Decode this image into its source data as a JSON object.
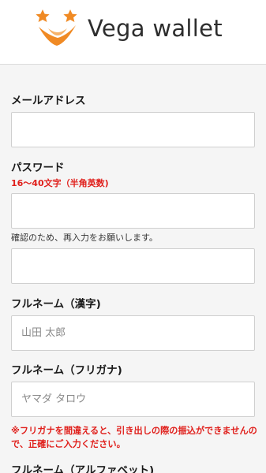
{
  "header": {
    "logo_text": "Vega wallet"
  },
  "form": {
    "email": {
      "label": "メールアドレス",
      "value": "",
      "placeholder": ""
    },
    "password": {
      "label": "パスワード",
      "rule": "16〜40文字（半角英数)",
      "value": "",
      "confirm_note": "確認のため、再入力をお願いします。",
      "confirm_value": ""
    },
    "fullname_kanji": {
      "label": "フルネーム（漢字)",
      "placeholder": "山田 太郎"
    },
    "fullname_kana": {
      "label": "フルネーム（フリガナ)",
      "placeholder": "ヤマダ タロウ"
    },
    "kana_warning": "※フリガナを間違えると、引き出しの際の振込ができませんので、正確にご入力ください。",
    "fullname_alpha": {
      "label": "フルネーム（アルファベット)"
    }
  },
  "colors": {
    "accent_orange": "#f08a24",
    "warning_red": "#e0201c"
  }
}
